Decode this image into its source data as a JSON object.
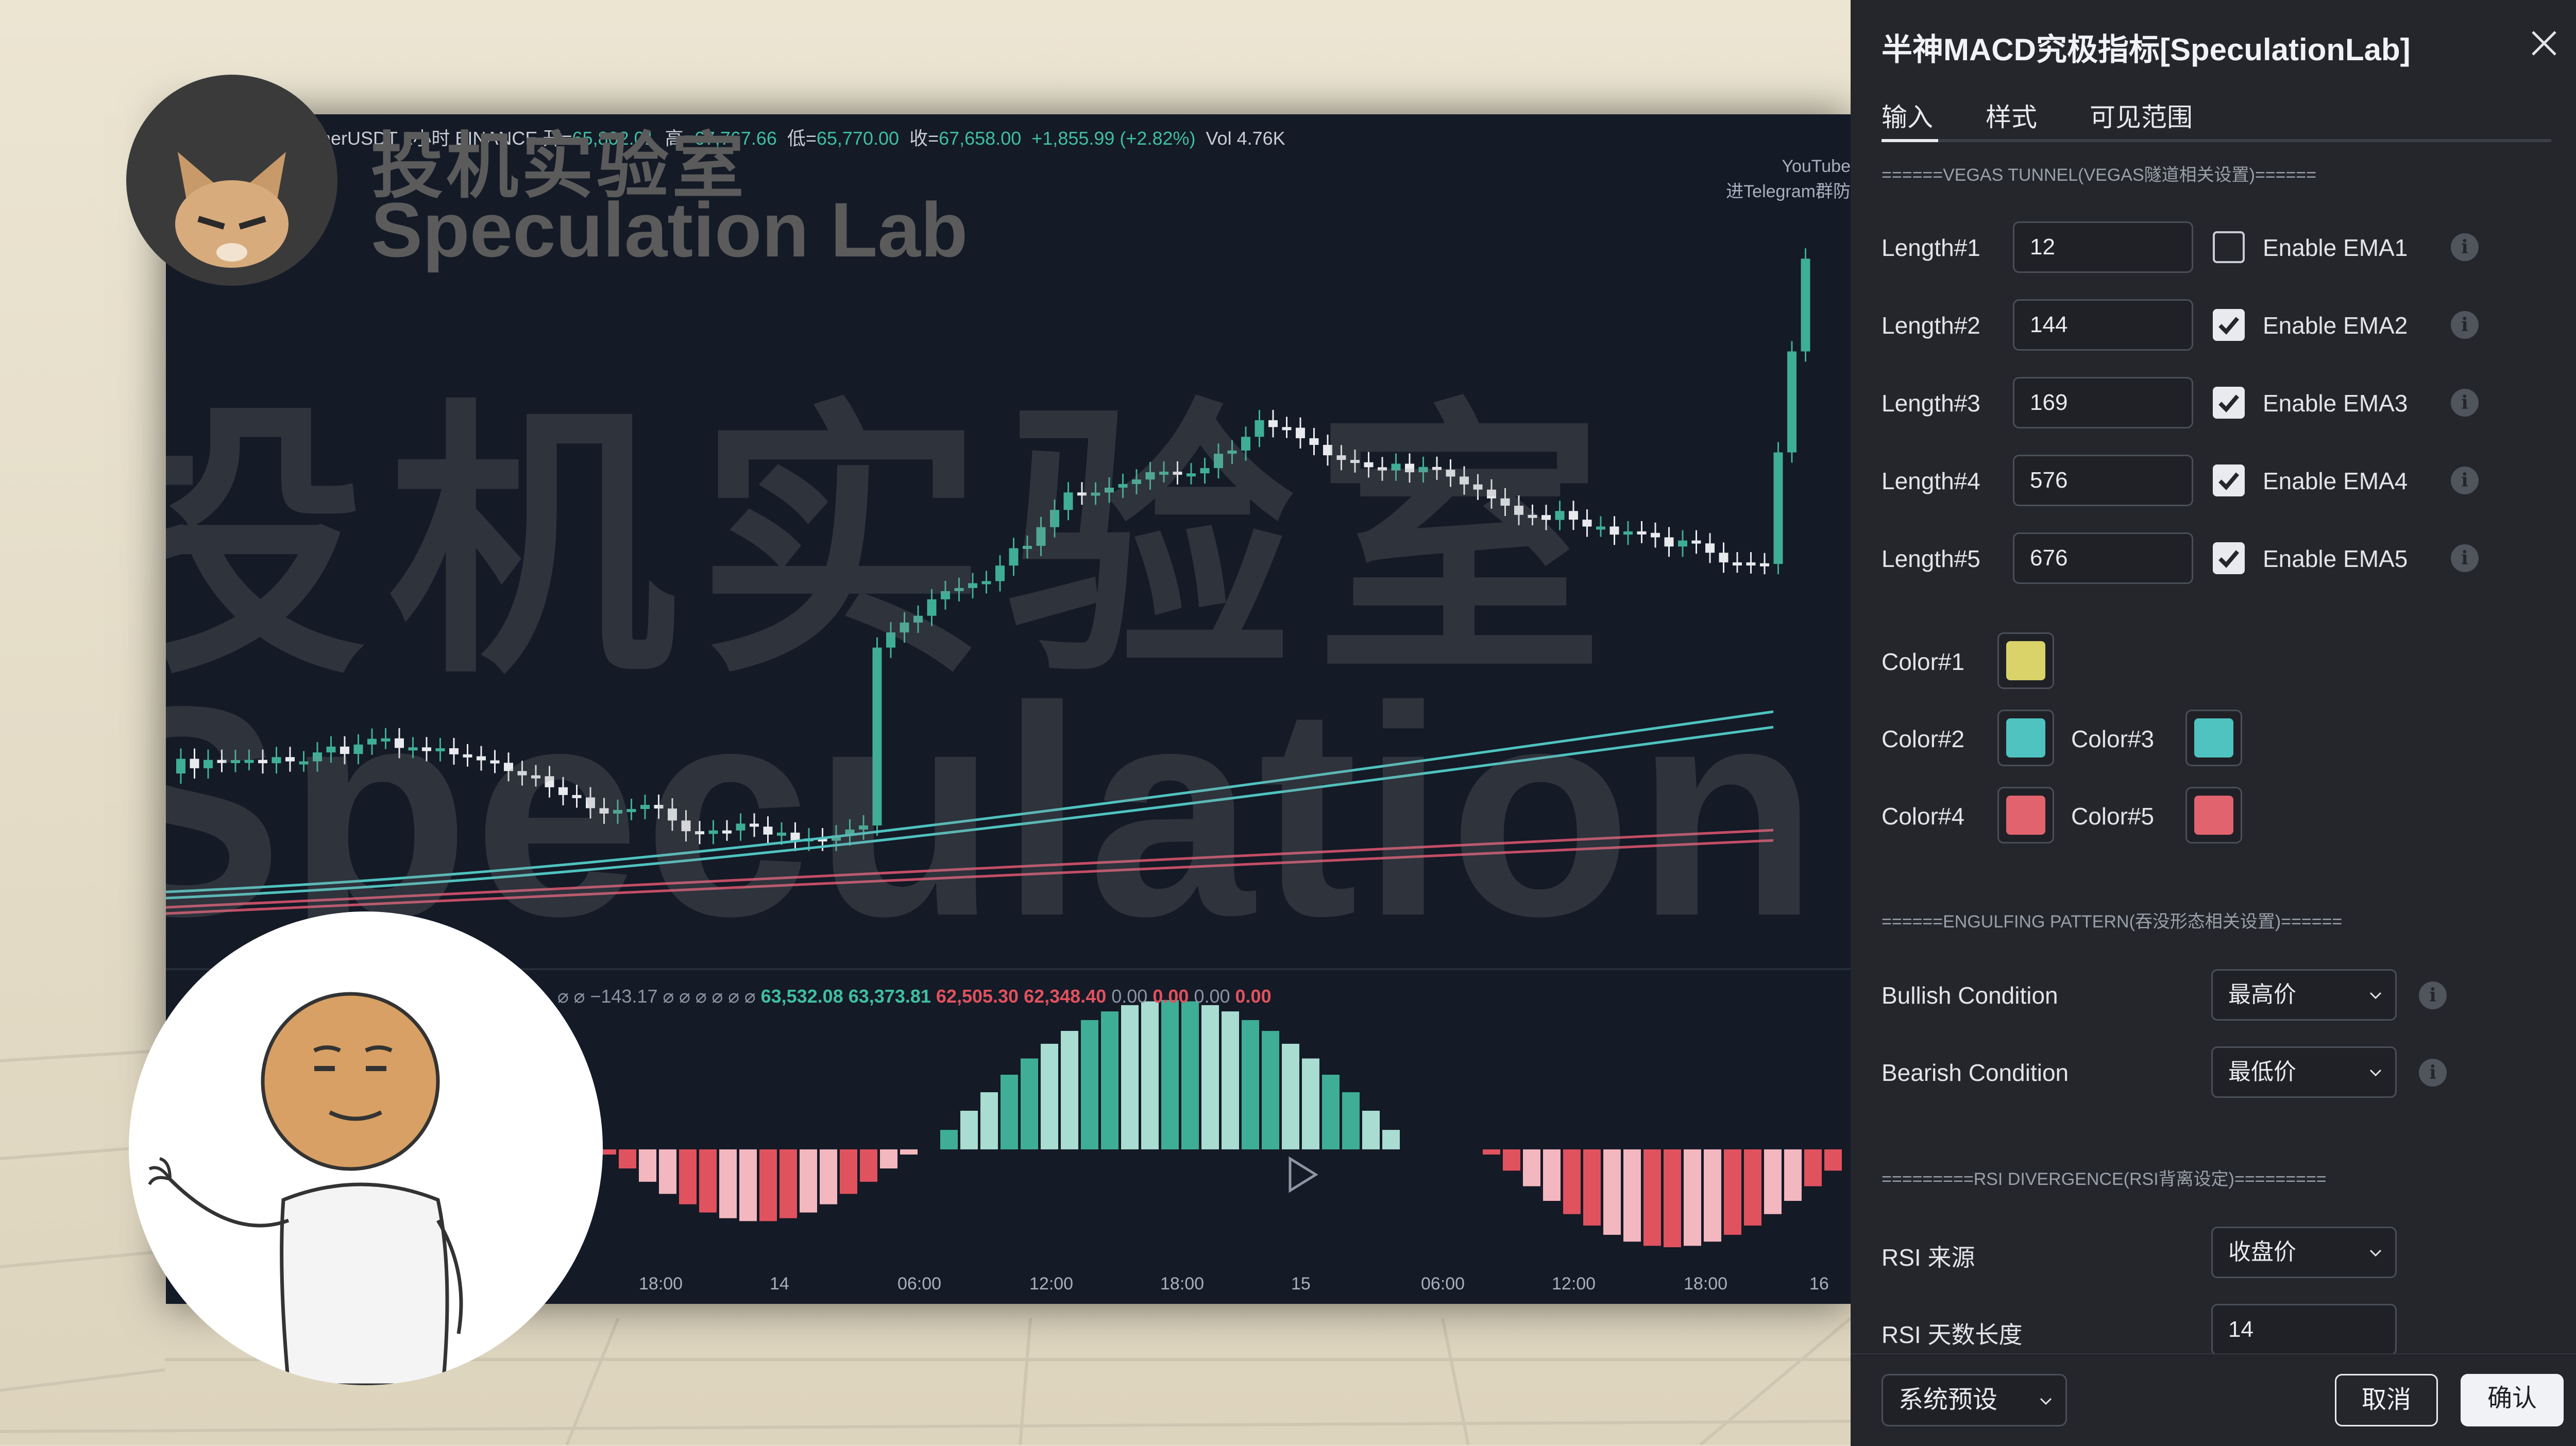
{
  "chart": {
    "ohlc_prefix": "herUSDT 1小时 BINANCE",
    "open_label": "开=",
    "open_value": "65,802.01",
    "high_label": "高=",
    "high_value": "67,767.66",
    "low_label": "低=",
    "low_value": "65,770.00",
    "close_label": "收=",
    "close_value": "67,658.00",
    "change": "+1,855.99 (+2.82%)",
    "volume": "Vol 4.76K",
    "macd_prefix": "⌀ ⌀ −143.17 ⌀ ⌀ ⌀ ⌀ ⌀ ⌀",
    "macd_g1": "63,532.08",
    "macd_g2": "63,373.81",
    "macd_r1": "62,505.30",
    "macd_r2": "62,348.40",
    "macd_z1": "0.00",
    "macd_z2": "0.00",
    "macd_z3": "0.00",
    "macd_z4": "0.00",
    "youtube": "YouTube",
    "telegram": "进Telegram群防",
    "time_labels": [
      "18:00",
      "14",
      "06:00",
      "12:00",
      "18:00",
      "15",
      "06:00",
      "12:00",
      "18:00",
      "16"
    ]
  },
  "watermark": {
    "cn": "投机实验室",
    "en": "Speculation Lab"
  },
  "logo": {
    "cn": "投机实验室",
    "en": "Speculation Lab"
  },
  "panel": {
    "title": "半神MACD究极指标[SpeculationLab]",
    "tabs": [
      "输入",
      "样式",
      "可见范围"
    ],
    "section_vegas": "======VEGAS TUNNEL(VEGAS隧道相关设置)======",
    "lengths": [
      {
        "label": "Length#1",
        "value": "12",
        "ema_label": "Enable EMA1",
        "checked": false
      },
      {
        "label": "Length#2",
        "value": "144",
        "ema_label": "Enable EMA2",
        "checked": true
      },
      {
        "label": "Length#3",
        "value": "169",
        "ema_label": "Enable EMA3",
        "checked": true
      },
      {
        "label": "Length#4",
        "value": "576",
        "ema_label": "Enable EMA4",
        "checked": true
      },
      {
        "label": "Length#5",
        "value": "676",
        "ema_label": "Enable EMA5",
        "checked": true
      }
    ],
    "colors": [
      {
        "label": "Color#1",
        "hex": "#d9d36a"
      },
      {
        "label": "Color#2",
        "hex": "#4fc3c0"
      },
      {
        "label": "Color#3",
        "hex": "#4fc3c0"
      },
      {
        "label": "Color#4",
        "hex": "#e0636e"
      },
      {
        "label": "Color#5",
        "hex": "#e0636e"
      }
    ],
    "section_engulfing": "======ENGULFING PATTERN(吞没形态相关设置)======",
    "bullish_label": "Bullish Condition",
    "bullish_value": "最高价",
    "bearish_label": "Bearish Condition",
    "bearish_value": "最低价",
    "section_rsi": "=========RSI DIVERGENCE(RSI背离设定)=========",
    "rsi_source_label": "RSI 来源",
    "rsi_source_value": "收盘价",
    "rsi_length_label": "RSI 天数长度",
    "rsi_length_value": "14",
    "preset_label": "系统预设",
    "cancel_label": "取消",
    "confirm_label": "确认"
  },
  "colors": {
    "up": "#3fae96",
    "up_light": "#a9ddd2",
    "down": "#e0525e",
    "down_light": "#f3b7bf",
    "panel_bg": "#24262b"
  }
}
